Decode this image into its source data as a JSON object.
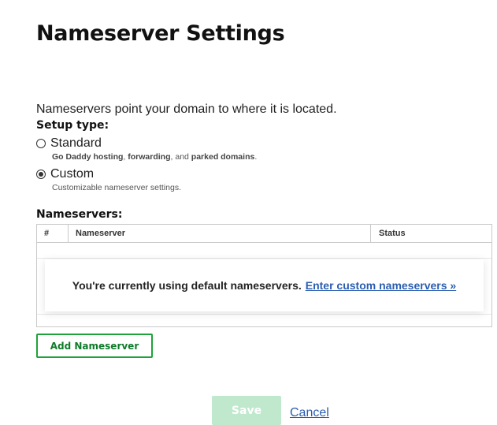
{
  "page": {
    "title": "Nameserver Settings",
    "intro": "Nameservers point your domain to where it is located."
  },
  "setup": {
    "label": "Setup type:",
    "options": [
      {
        "label": "Standard",
        "selected": false,
        "description_parts": [
          "Go Daddy hosting",
          ", ",
          "forwarding",
          ", and ",
          "parked domains",
          "."
        ]
      },
      {
        "label": "Custom",
        "selected": true,
        "description": "Customizable nameserver settings."
      }
    ]
  },
  "nameservers": {
    "label": "Nameservers:",
    "columns": [
      "#",
      "Nameserver",
      "Status"
    ],
    "notice_text": "You're currently using default nameservers.",
    "notice_link": "Enter custom nameservers »",
    "add_button": "Add Nameserver"
  },
  "footer": {
    "save_label": "Save",
    "cancel_label": "Cancel"
  },
  "colors": {
    "accent_green": "#1ea33a",
    "save_disabled": "#bfe8cd",
    "link_blue": "#2a5db0"
  }
}
